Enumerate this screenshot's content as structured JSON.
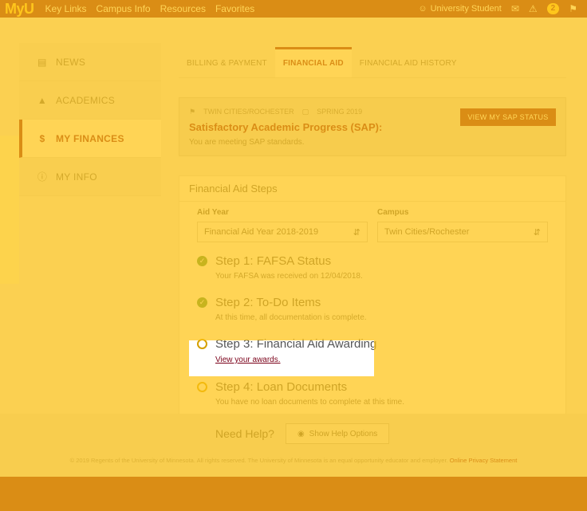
{
  "app": {
    "logo": "MyU",
    "nav": [
      "Key Links",
      "Campus Info",
      "Resources",
      "Favorites"
    ],
    "user_name": "University Student",
    "alert_count": "2"
  },
  "sidebar": {
    "items": [
      {
        "label": "NEWS",
        "icon": "newspaper-icon"
      },
      {
        "label": "ACADEMICS",
        "icon": "graduation-cap-icon"
      },
      {
        "label": "MY FINANCES",
        "icon": "dollar-icon",
        "active": true
      },
      {
        "label": "MY INFO",
        "icon": "info-icon"
      }
    ]
  },
  "tabs": [
    "BILLING & PAYMENT",
    "FINANCIAL AID",
    "FINANCIAL AID HISTORY"
  ],
  "sap": {
    "campus": "TWIN CITIES/ROCHESTER",
    "term": "SPRING 2019",
    "title": "Satisfactory Academic Progress (SAP):",
    "status": "You are meeting SAP standards.",
    "button": "VIEW MY SAP STATUS"
  },
  "steps_card": {
    "heading": "Financial Aid Steps",
    "aid_year_label": "Aid Year",
    "aid_year_value": "Financial Aid Year 2018-2019",
    "campus_label": "Campus",
    "campus_value": "Twin Cities/Rochester",
    "steps": [
      {
        "title": "Step 1: FAFSA Status",
        "detail": "Your FAFSA was received on 12/04/2018."
      },
      {
        "title": "Step 2: To-Do Items",
        "detail": "At this time, all documentation is complete."
      },
      {
        "title": "Step 3: Financial Aid Awarding",
        "link": "View your awards."
      },
      {
        "title": "Step 4: Loan Documents",
        "detail": "You have no loan documents to complete at this time."
      }
    ]
  },
  "help": {
    "label": "Need Help?",
    "button": "Show Help Options"
  },
  "footer": {
    "text": "© 2019 Regents of the University of Minnesota. All rights reserved. The University of Minnesota is an equal opportunity educator and employer.",
    "link": "Online Privacy Statement"
  }
}
